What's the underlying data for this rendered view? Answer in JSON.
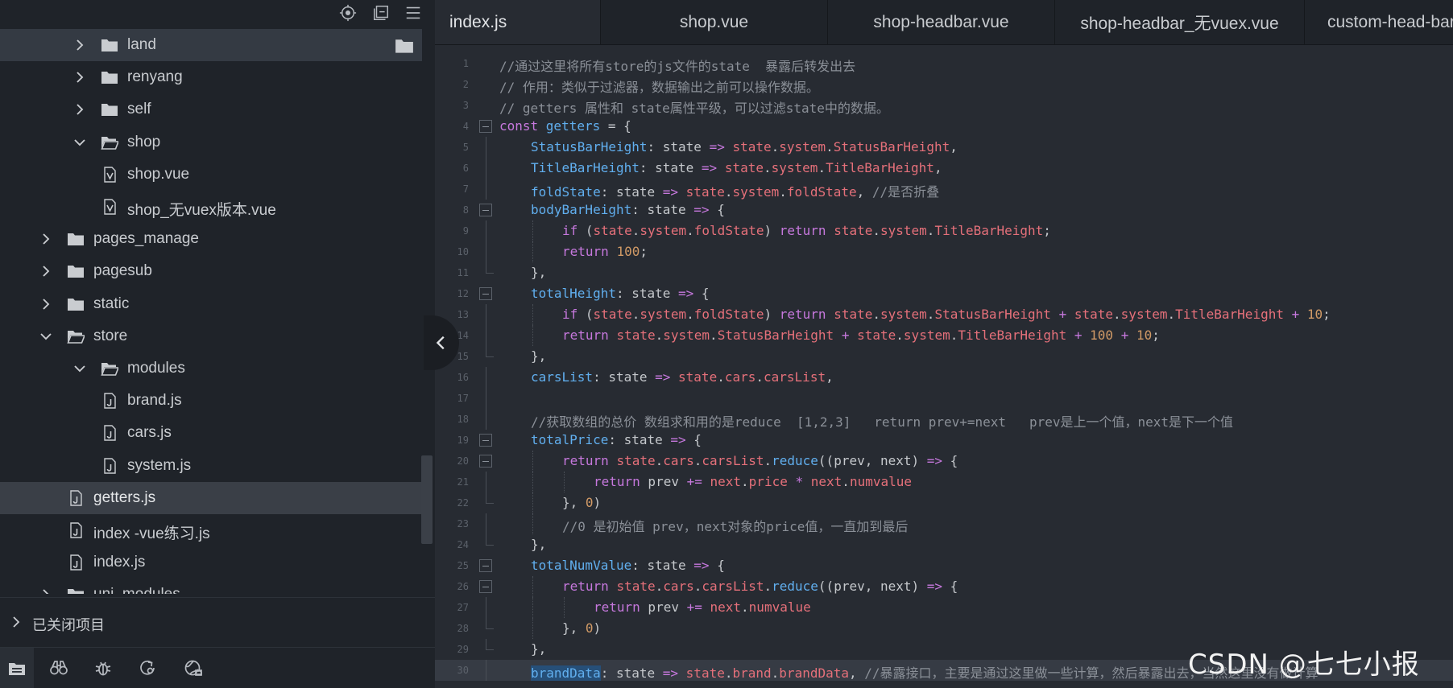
{
  "sidebar": {
    "toolbar_icons": [
      "locate-icon",
      "collapse-all-icon",
      "menu-icon"
    ],
    "tree": [
      {
        "label": "land",
        "type": "folder",
        "expanded": false,
        "depth": 1,
        "hovered": true
      },
      {
        "label": "renyang",
        "type": "folder",
        "expanded": false,
        "depth": 1
      },
      {
        "label": "self",
        "type": "folder",
        "expanded": false,
        "depth": 1
      },
      {
        "label": "shop",
        "type": "folder",
        "expanded": true,
        "depth": 1
      },
      {
        "label": "shop.vue",
        "type": "vue-file",
        "depth": 2
      },
      {
        "label": "shop_无vuex版本.vue",
        "type": "vue-file",
        "depth": 2
      },
      {
        "label": "pages_manage",
        "type": "folder",
        "expanded": false,
        "depth": 0
      },
      {
        "label": "pagesub",
        "type": "folder",
        "expanded": false,
        "depth": 0
      },
      {
        "label": "static",
        "type": "folder",
        "expanded": false,
        "depth": 0
      },
      {
        "label": "store",
        "type": "folder",
        "expanded": true,
        "depth": 0
      },
      {
        "label": "modules",
        "type": "folder",
        "expanded": true,
        "depth": 1
      },
      {
        "label": "brand.js",
        "type": "js-file",
        "depth": 2
      },
      {
        "label": "cars.js",
        "type": "js-file",
        "depth": 2
      },
      {
        "label": "system.js",
        "type": "js-file",
        "depth": 2
      },
      {
        "label": "getters.js",
        "type": "js-file",
        "depth": 1,
        "selected": true
      },
      {
        "label": "index -vue练习.js",
        "type": "js-file",
        "depth": 1
      },
      {
        "label": "index.js",
        "type": "js-file",
        "depth": 1
      },
      {
        "label": "uni_modules",
        "type": "folder",
        "expanded": false,
        "depth": 0
      }
    ],
    "closed_projects_label": "已关闭项目",
    "bottom_icons": [
      "project-manager-icon",
      "search-binoculars-icon",
      "debug-bug-icon",
      "plugin-refresh-icon",
      "cloud-browser-icon"
    ]
  },
  "editor": {
    "tabs": [
      {
        "label": "index.js",
        "active": true
      },
      {
        "label": "shop.vue"
      },
      {
        "label": "shop-headbar.vue"
      },
      {
        "label": "shop-headbar_无vuex.vue"
      },
      {
        "label": "custom-head-bar.vue"
      }
    ],
    "lines": [
      {
        "n": "1",
        "indent": 0,
        "tokens": [
          [
            "cm",
            "//通过这里将所有store的js文件的state  暴露后转发出去"
          ]
        ]
      },
      {
        "n": "2",
        "indent": 0,
        "tokens": [
          [
            "cm",
            "// 作用：类似于过滤器，数据输出之前可以操作数据。"
          ]
        ]
      },
      {
        "n": "3",
        "indent": 0,
        "tokens": [
          [
            "cm",
            "// getters 属性和 state属性平级，可以过滤state中的数据。"
          ]
        ]
      },
      {
        "n": "4",
        "indent": 0,
        "fold": true,
        "tokens": [
          [
            "kw",
            "const "
          ],
          [
            "def",
            "getters"
          ],
          [
            "pl",
            " = {"
          ]
        ]
      },
      {
        "n": "5",
        "indent": 1,
        "tokens": [
          [
            "def",
            "StatusBarHeight"
          ],
          [
            "pl",
            ": state "
          ],
          [
            "op",
            "=>"
          ],
          [
            "pl",
            " "
          ],
          [
            "obj",
            "state"
          ],
          [
            "pl",
            "."
          ],
          [
            "obj",
            "system"
          ],
          [
            "pl",
            "."
          ],
          [
            "obj",
            "StatusBarHeight"
          ],
          [
            "pl",
            ","
          ]
        ]
      },
      {
        "n": "6",
        "indent": 1,
        "tokens": [
          [
            "def",
            "TitleBarHeight"
          ],
          [
            "pl",
            ": state "
          ],
          [
            "op",
            "=>"
          ],
          [
            "pl",
            " "
          ],
          [
            "obj",
            "state"
          ],
          [
            "pl",
            "."
          ],
          [
            "obj",
            "system"
          ],
          [
            "pl",
            "."
          ],
          [
            "obj",
            "TitleBarHeight"
          ],
          [
            "pl",
            ","
          ]
        ]
      },
      {
        "n": "7",
        "indent": 1,
        "tokens": [
          [
            "def",
            "foldState"
          ],
          [
            "pl",
            ": state "
          ],
          [
            "op",
            "=>"
          ],
          [
            "pl",
            " "
          ],
          [
            "obj",
            "state"
          ],
          [
            "pl",
            "."
          ],
          [
            "obj",
            "system"
          ],
          [
            "pl",
            "."
          ],
          [
            "obj",
            "foldState"
          ],
          [
            "pl",
            ", "
          ],
          [
            "cm",
            "//是否折叠"
          ]
        ]
      },
      {
        "n": "8",
        "indent": 1,
        "fold": true,
        "tokens": [
          [
            "def",
            "bodyBarHeight"
          ],
          [
            "pl",
            ": state "
          ],
          [
            "op",
            "=>"
          ],
          [
            "pl",
            " {"
          ]
        ]
      },
      {
        "n": "9",
        "indent": 2,
        "tokens": [
          [
            "kw",
            "if"
          ],
          [
            "pl",
            " ("
          ],
          [
            "obj",
            "state"
          ],
          [
            "pl",
            "."
          ],
          [
            "obj",
            "system"
          ],
          [
            "pl",
            "."
          ],
          [
            "obj",
            "foldState"
          ],
          [
            "pl",
            ") "
          ],
          [
            "kw",
            "return"
          ],
          [
            "pl",
            " "
          ],
          [
            "obj",
            "state"
          ],
          [
            "pl",
            "."
          ],
          [
            "obj",
            "system"
          ],
          [
            "pl",
            "."
          ],
          [
            "obj",
            "TitleBarHeight"
          ],
          [
            "pl",
            ";"
          ]
        ]
      },
      {
        "n": "10",
        "indent": 2,
        "tokens": [
          [
            "kw",
            "return"
          ],
          [
            "pl",
            " "
          ],
          [
            "num",
            "100"
          ],
          [
            "pl",
            ";"
          ]
        ]
      },
      {
        "n": "11",
        "indent": 1,
        "foldEnd": true,
        "tokens": [
          [
            "pl",
            "},"
          ]
        ]
      },
      {
        "n": "12",
        "indent": 1,
        "fold": true,
        "tokens": [
          [
            "def",
            "totalHeight"
          ],
          [
            "pl",
            ": state "
          ],
          [
            "op",
            "=>"
          ],
          [
            "pl",
            " {"
          ]
        ]
      },
      {
        "n": "13",
        "indent": 2,
        "tokens": [
          [
            "kw",
            "if"
          ],
          [
            "pl",
            " ("
          ],
          [
            "obj",
            "state"
          ],
          [
            "pl",
            "."
          ],
          [
            "obj",
            "system"
          ],
          [
            "pl",
            "."
          ],
          [
            "obj",
            "foldState"
          ],
          [
            "pl",
            ") "
          ],
          [
            "kw",
            "return"
          ],
          [
            "pl",
            " "
          ],
          [
            "obj",
            "state"
          ],
          [
            "pl",
            "."
          ],
          [
            "obj",
            "system"
          ],
          [
            "pl",
            "."
          ],
          [
            "obj",
            "StatusBarHeight"
          ],
          [
            "pl",
            " "
          ],
          [
            "op",
            "+"
          ],
          [
            "pl",
            " "
          ],
          [
            "obj",
            "state"
          ],
          [
            "pl",
            "."
          ],
          [
            "obj",
            "system"
          ],
          [
            "pl",
            "."
          ],
          [
            "obj",
            "TitleBarHeight"
          ],
          [
            "pl",
            " "
          ],
          [
            "op",
            "+"
          ],
          [
            "pl",
            " "
          ],
          [
            "num",
            "10"
          ],
          [
            "pl",
            ";"
          ]
        ]
      },
      {
        "n": "14",
        "indent": 2,
        "tokens": [
          [
            "kw",
            "return"
          ],
          [
            "pl",
            " "
          ],
          [
            "obj",
            "state"
          ],
          [
            "pl",
            "."
          ],
          [
            "obj",
            "system"
          ],
          [
            "pl",
            "."
          ],
          [
            "obj",
            "StatusBarHeight"
          ],
          [
            "pl",
            " "
          ],
          [
            "op",
            "+"
          ],
          [
            "pl",
            " "
          ],
          [
            "obj",
            "state"
          ],
          [
            "pl",
            "."
          ],
          [
            "obj",
            "system"
          ],
          [
            "pl",
            "."
          ],
          [
            "obj",
            "TitleBarHeight"
          ],
          [
            "pl",
            " "
          ],
          [
            "op",
            "+"
          ],
          [
            "pl",
            " "
          ],
          [
            "num",
            "100"
          ],
          [
            "pl",
            " "
          ],
          [
            "op",
            "+"
          ],
          [
            "pl",
            " "
          ],
          [
            "num",
            "10"
          ],
          [
            "pl",
            ";"
          ]
        ]
      },
      {
        "n": "15",
        "indent": 1,
        "foldEnd": true,
        "tokens": [
          [
            "pl",
            "},"
          ]
        ]
      },
      {
        "n": "16",
        "indent": 1,
        "tokens": [
          [
            "def",
            "carsList"
          ],
          [
            "pl",
            ": state "
          ],
          [
            "op",
            "=>"
          ],
          [
            "pl",
            " "
          ],
          [
            "obj",
            "state"
          ],
          [
            "pl",
            "."
          ],
          [
            "obj",
            "cars"
          ],
          [
            "pl",
            "."
          ],
          [
            "obj",
            "carsList"
          ],
          [
            "pl",
            ","
          ]
        ]
      },
      {
        "n": "17",
        "indent": 1,
        "tokens": []
      },
      {
        "n": "18",
        "indent": 1,
        "tokens": [
          [
            "cm",
            "//获取数组的总价 数组求和用的是reduce  [1,2,3]   return prev+=next   prev是上一个值，next是下一个值"
          ]
        ]
      },
      {
        "n": "19",
        "indent": 1,
        "fold": true,
        "tokens": [
          [
            "def",
            "totalPrice"
          ],
          [
            "pl",
            ": state "
          ],
          [
            "op",
            "=>"
          ],
          [
            "pl",
            " {"
          ]
        ]
      },
      {
        "n": "20",
        "indent": 2,
        "fold": true,
        "tokens": [
          [
            "kw",
            "return"
          ],
          [
            "pl",
            " "
          ],
          [
            "obj",
            "state"
          ],
          [
            "pl",
            "."
          ],
          [
            "obj",
            "cars"
          ],
          [
            "pl",
            "."
          ],
          [
            "obj",
            "carsList"
          ],
          [
            "pl",
            "."
          ],
          [
            "def",
            "reduce"
          ],
          [
            "pl",
            "((prev, next) "
          ],
          [
            "op",
            "=>"
          ],
          [
            "pl",
            " {"
          ]
        ]
      },
      {
        "n": "21",
        "indent": 3,
        "tokens": [
          [
            "kw",
            "return"
          ],
          [
            "pl",
            " prev "
          ],
          [
            "op",
            "+="
          ],
          [
            "pl",
            " "
          ],
          [
            "obj",
            "next"
          ],
          [
            "pl",
            "."
          ],
          [
            "obj",
            "price"
          ],
          [
            "pl",
            " "
          ],
          [
            "op",
            "*"
          ],
          [
            "pl",
            " "
          ],
          [
            "obj",
            "next"
          ],
          [
            "pl",
            "."
          ],
          [
            "obj",
            "numvalue"
          ]
        ]
      },
      {
        "n": "22",
        "indent": 2,
        "foldEnd": true,
        "tokens": [
          [
            "pl",
            "}, "
          ],
          [
            "num",
            "0"
          ],
          [
            "pl",
            ")"
          ]
        ]
      },
      {
        "n": "23",
        "indent": 2,
        "tokens": [
          [
            "cm",
            "//0 是初始值 prev，next对象的price值，一直加到最后"
          ]
        ]
      },
      {
        "n": "24",
        "indent": 1,
        "foldEnd": true,
        "tokens": [
          [
            "pl",
            "},"
          ]
        ]
      },
      {
        "n": "25",
        "indent": 1,
        "fold": true,
        "tokens": [
          [
            "def",
            "totalNumValue"
          ],
          [
            "pl",
            ": state "
          ],
          [
            "op",
            "=>"
          ],
          [
            "pl",
            " {"
          ]
        ]
      },
      {
        "n": "26",
        "indent": 2,
        "fold": true,
        "tokens": [
          [
            "kw",
            "return"
          ],
          [
            "pl",
            " "
          ],
          [
            "obj",
            "state"
          ],
          [
            "pl",
            "."
          ],
          [
            "obj",
            "cars"
          ],
          [
            "pl",
            "."
          ],
          [
            "obj",
            "carsList"
          ],
          [
            "pl",
            "."
          ],
          [
            "def",
            "reduce"
          ],
          [
            "pl",
            "((prev, next) "
          ],
          [
            "op",
            "=>"
          ],
          [
            "pl",
            " {"
          ]
        ]
      },
      {
        "n": "27",
        "indent": 3,
        "tokens": [
          [
            "kw",
            "return"
          ],
          [
            "pl",
            " prev "
          ],
          [
            "op",
            "+="
          ],
          [
            "pl",
            " "
          ],
          [
            "obj",
            "next"
          ],
          [
            "pl",
            "."
          ],
          [
            "obj",
            "numvalue"
          ]
        ]
      },
      {
        "n": "28",
        "indent": 2,
        "foldEnd": true,
        "tokens": [
          [
            "pl",
            "}, "
          ],
          [
            "num",
            "0"
          ],
          [
            "pl",
            ")"
          ]
        ]
      },
      {
        "n": "29",
        "indent": 1,
        "foldEnd": true,
        "tokens": [
          [
            "pl",
            "},"
          ]
        ]
      },
      {
        "n": "30",
        "indent": 1,
        "highlight": true,
        "tokens": [
          [
            "sel",
            "brandData"
          ],
          [
            "pl",
            ": state "
          ],
          [
            "op",
            "=>"
          ],
          [
            "pl",
            " "
          ],
          [
            "obj",
            "state"
          ],
          [
            "pl",
            "."
          ],
          [
            "obj",
            "brand"
          ],
          [
            "pl",
            "."
          ],
          [
            "obj",
            "brandData"
          ],
          [
            "pl",
            ", "
          ],
          [
            "cm",
            "//暴露接口，主要是通过这里做一些计算，然后暴露出去，当然这里没有做计算"
          ]
        ]
      }
    ]
  },
  "watermark": "CSDN @七七小报",
  "colors": {
    "sidebar_bg": "#1f2329",
    "editor_bg": "#272b32",
    "comment": "#8b9098",
    "keyword": "#c678dd",
    "property": "#61afef",
    "object": "#e5707a",
    "number": "#d19a66"
  }
}
